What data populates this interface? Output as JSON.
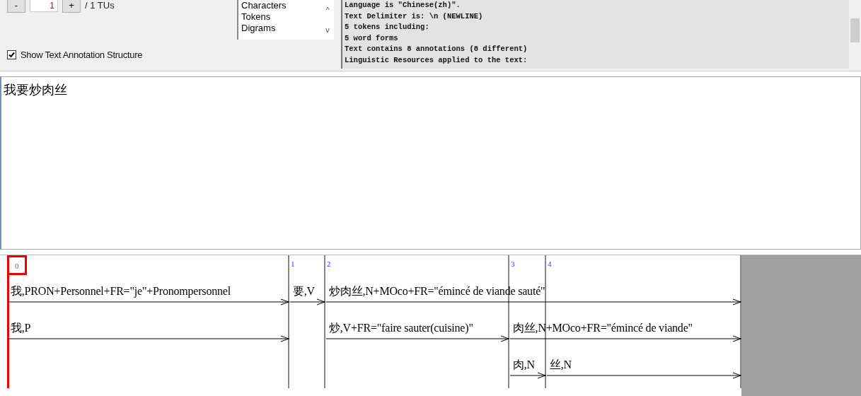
{
  "tu_nav": {
    "minus": "-",
    "value": "1",
    "plus": "+",
    "total": "/ 1 TUs"
  },
  "view_list": {
    "items": [
      {
        "label": "Characters",
        "selected": false
      },
      {
        "label": "Tokens",
        "selected": false
      },
      {
        "label": "Digrams",
        "selected": false
      }
    ],
    "up": "^",
    "down": "v"
  },
  "show_structure": {
    "label": "Show Text Annotation Structure",
    "checked": true
  },
  "info_lines": [
    "Language is \"Chinese(zh)\".",
    "Text Delimiter is: \\n (NEWLINE)",
    "5 tokens including:",
    "5 word forms",
    "Text contains 8 annotations (8 different)",
    "Linguistic Resources applied to the text:"
  ],
  "text": "我要炒肉丝",
  "nodes": [
    {
      "label": "0",
      "selected": true
    },
    {
      "label": "1",
      "selected": false
    },
    {
      "label": "2",
      "selected": false
    },
    {
      "label": "3",
      "selected": false
    },
    {
      "label": "4",
      "selected": false
    }
  ],
  "annotation_rows": [
    [
      {
        "kind": "start",
        "text": "我,PRON+Personnel+FR=\"je\"+Pronompersonnel"
      },
      {
        "kind": "start",
        "text": "要,V"
      },
      {
        "kind": "start",
        "text": "炒肉丝,N+MOco+FR=\"émincé de viande sauté\""
      },
      {
        "kind": "continue"
      },
      {
        "kind": "continue"
      }
    ],
    [
      {
        "kind": "start",
        "text": "我,P"
      },
      {
        "kind": "empty"
      },
      {
        "kind": "start",
        "text": "炒,V+FR=\"faire sauter(cuisine)\""
      },
      {
        "kind": "start",
        "text": "肉丝,N+MOco+FR=\"émincé de viande\""
      },
      {
        "kind": "continue"
      }
    ],
    [
      {
        "kind": "empty"
      },
      {
        "kind": "empty"
      },
      {
        "kind": "empty"
      },
      {
        "kind": "start",
        "text": "肉,N"
      },
      {
        "kind": "start",
        "text": "丝,N"
      }
    ]
  ]
}
